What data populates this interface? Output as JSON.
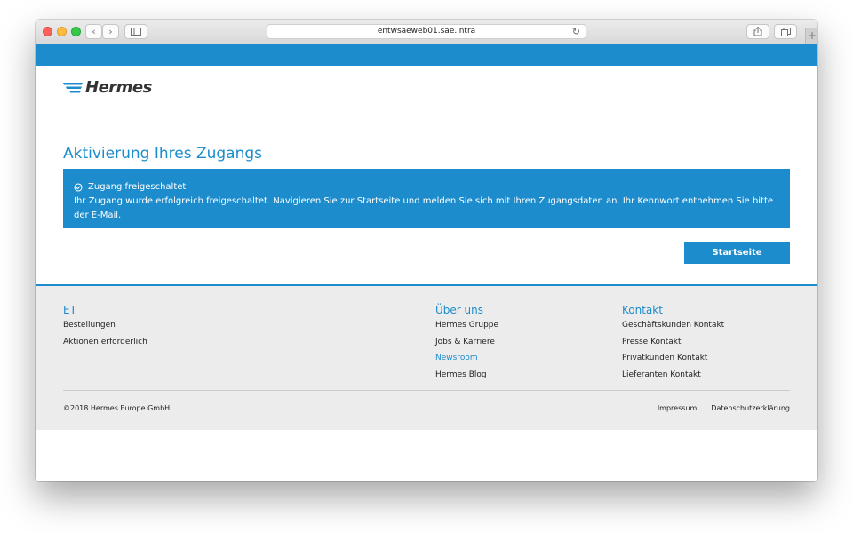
{
  "browser": {
    "url": "entwsaeweb01.sae.intra"
  },
  "brand": {
    "name": "Hermes",
    "color": "#1c8ccc"
  },
  "main": {
    "title": "Aktivierung Ihres Zugangs",
    "alert": {
      "title": "Zugang freigeschaltet",
      "message": "Ihr Zugang wurde erfolgreich freigeschaltet. Navigieren Sie zur Startseite und melden Sie sich mit Ihren Zugangsdaten an. Ihr Kennwort entnehmen Sie bitte der E-Mail."
    },
    "start_button": "Startseite"
  },
  "footer": {
    "columns": [
      {
        "heading": "ET",
        "links": [
          "Bestellungen",
          "Aktionen erforderlich"
        ]
      },
      {
        "heading": "Über uns",
        "links": [
          "Hermes Gruppe",
          "Jobs & Karriere",
          "Newsroom",
          "Hermes Blog"
        ]
      },
      {
        "heading": "Kontakt",
        "links": [
          "Geschäftskunden Kontakt",
          "Presse Kontakt",
          "Privatkunden Kontakt",
          "Lieferanten Kontakt"
        ]
      }
    ],
    "copyright": "©2018 Hermes Europe GmbH",
    "legal": [
      "Impressum",
      "Datenschutzerklärung"
    ]
  }
}
